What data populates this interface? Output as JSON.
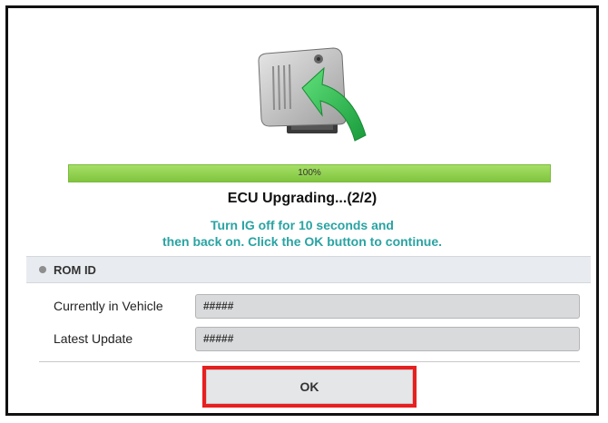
{
  "progress": {
    "label": "100%",
    "value": 1.0,
    "color": "#8fd14f"
  },
  "status": {
    "title": "ECU Upgrading...(2/2)"
  },
  "instruction": {
    "line1": "Turn IG off for 10 seconds and",
    "line2": "then back on. Click the OK button to continue.",
    "color": "#2aa3a3"
  },
  "rom": {
    "section_label": "ROM ID",
    "rows": [
      {
        "label": "Currently in Vehicle",
        "value": "#####"
      },
      {
        "label": "Latest Update",
        "value": "#####"
      }
    ]
  },
  "actions": {
    "ok_label": "OK",
    "highlight_color": "#e81f1f"
  },
  "icons": {
    "hero": "ecu-upgrade-icon"
  }
}
